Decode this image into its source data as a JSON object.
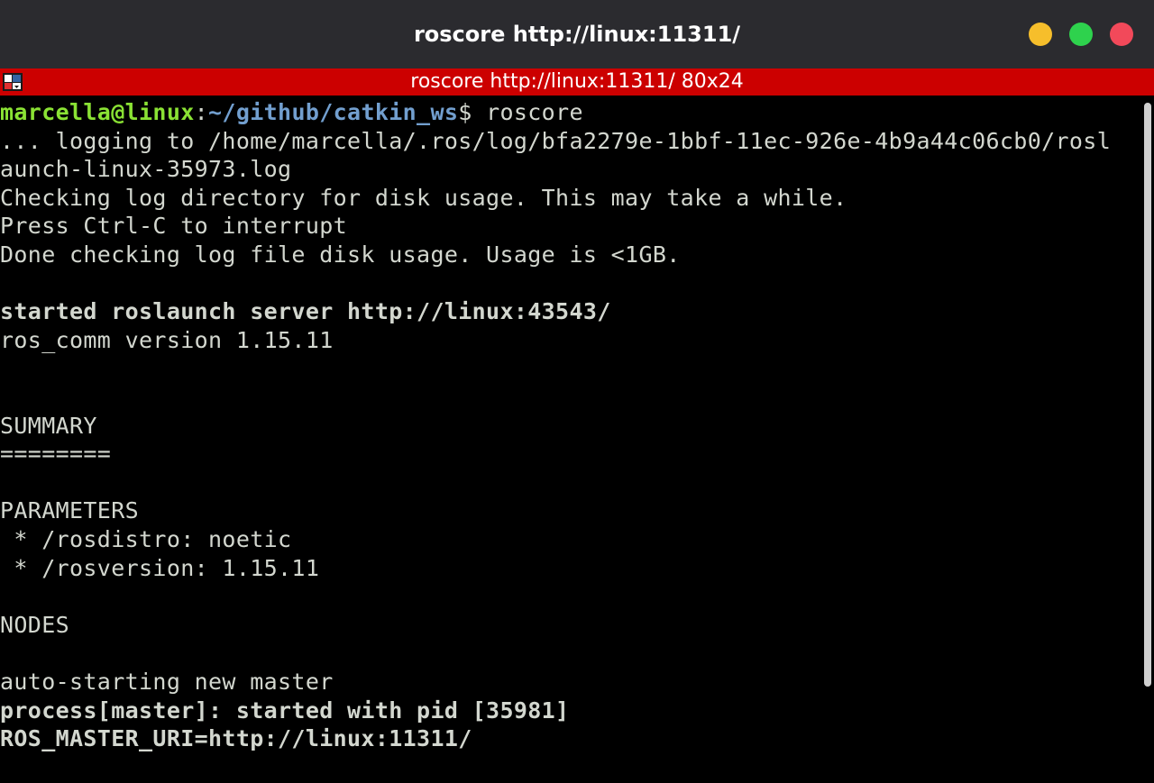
{
  "window": {
    "title": "roscore http://linux:11311/"
  },
  "tab": {
    "title": "roscore http://linux:11311/ 80x24"
  },
  "prompt": {
    "user_host": "marcella@linux",
    "separator": ":",
    "path": "~/github/catkin_ws",
    "dollar": "$",
    "command": " roscore"
  },
  "output": [
    "... logging to /home/marcella/.ros/log/bfa2279e-1bbf-11ec-926e-4b9a44c06cb0/rosl",
    "aunch-linux-35973.log",
    "Checking log directory for disk usage. This may take a while.",
    "Press Ctrl-C to interrupt",
    "Done checking log file disk usage. Usage is <1GB.",
    "",
    "started roslaunch server http://linux:43543/",
    "ros_comm version 1.15.11",
    "",
    "",
    "SUMMARY",
    "========",
    "",
    "PARAMETERS",
    " * /rosdistro: noetic",
    " * /rosversion: 1.15.11",
    "",
    "NODES",
    "",
    "auto-starting new master",
    "process[master]: started with pid [35981]",
    "ROS_MASTER_URI=http://linux:11311/"
  ],
  "icons": {
    "window_controls": [
      "minimize-icon",
      "maximize-icon",
      "close-icon"
    ],
    "tab_menu": "terminal-menu-icon"
  },
  "colors": {
    "titlebar": "#2b2b2f",
    "tabbar": "#cc0000",
    "terminal_bg": "#000000",
    "terminal_fg": "#d3d7cf",
    "prompt_user": "#8ae234",
    "prompt_path": "#729fcf",
    "btn_minimize": "#f6be2b",
    "btn_maximize": "#2ed24d",
    "btn_close": "#f2495a"
  }
}
